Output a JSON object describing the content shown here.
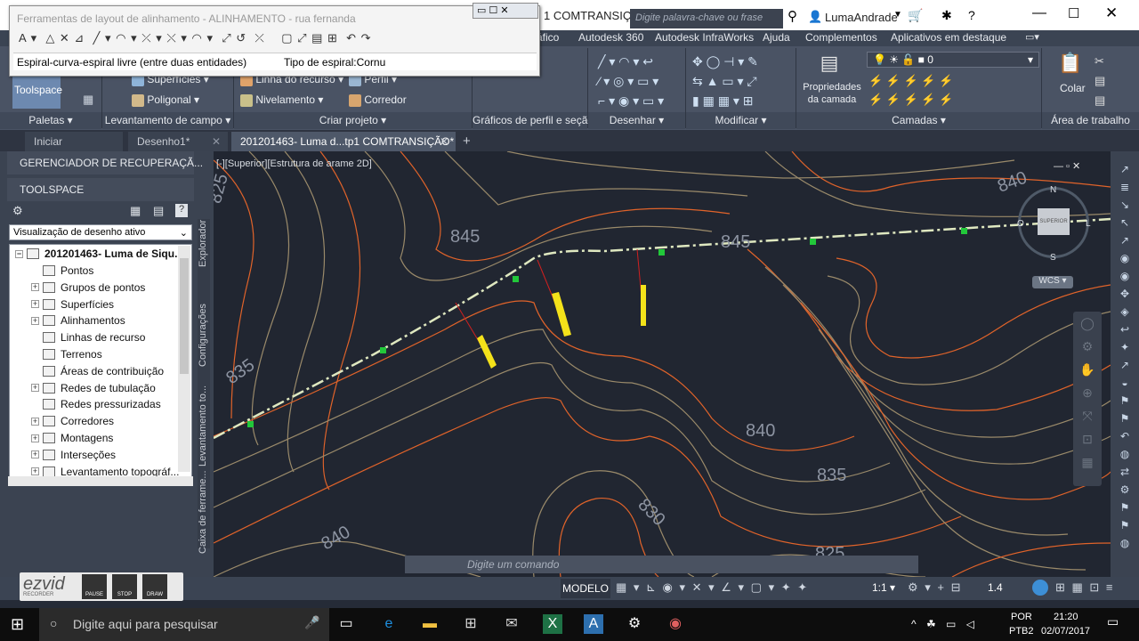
{
  "window": {
    "title_fragment": "1 COMTRANSIÇ...",
    "search_placeholder": "Digite palavra-chave ou frase",
    "user": "LumaAndrade"
  },
  "menu": [
    "áfico",
    "Autodesk 360",
    "Autodesk InfraWorks",
    "Ajuda",
    "Complementos",
    "Aplicativos em destaque"
  ],
  "ribbon": {
    "toolspace": "Toolspace",
    "superficies": "Superfícies",
    "poligonal": "Poligonal",
    "linha_recurso": "Linha do recurso",
    "nivelamento": "Nivelamento",
    "perfil": "Perfil",
    "corredor": "Corredor",
    "propriedades_camada": "Propriedades",
    "propriedades_camada2": "da camada",
    "layer_value": "0",
    "colar": "Colar",
    "panels": {
      "paletas": "Paletas",
      "levantamento": "Levantamento de campo",
      "criar_projeto": "Criar projeto",
      "graficos": "Gráficos de perfil e seção",
      "desenhar": "Desenhar",
      "modificar": "Modificar",
      "camadas": "Camadas",
      "area_trabalho": "Área de trabalho"
    }
  },
  "tabs": [
    "Iniciar",
    "Desenho1*",
    "201201463- Luma d...tp1 COMTRANSIÇÃO*"
  ],
  "floating_toolbar": {
    "title": "Ferramentas de layout de alinhamento - ALINHAMENTO - rua fernanda",
    "status_left": "Espiral-curva-espiral livre (entre duas entidades)",
    "status_right": "Tipo de espiral:Cornu"
  },
  "left_panel": {
    "recovery": "GERENCIADOR DE RECUPERAÇÃ...",
    "toolspace": "TOOLSPACE",
    "view_select": "Visualização de desenho ativo",
    "root": "201201463- Luma de Siqu...",
    "items": [
      "Pontos",
      "Grupos de pontos",
      "Superfícies",
      "Alinhamentos",
      "Linhas de recurso",
      "Terrenos",
      "Áreas de contribuição",
      "Redes de tubulação",
      "Redes pressurizadas",
      "Corredores",
      "Montagens",
      "Interseções",
      "Levantamento topográf..."
    ],
    "vtabs": [
      "Explorador",
      "Configurações",
      "Levantamento to...",
      "Caixa de ferrame..."
    ]
  },
  "canvas": {
    "view_label": "[-][Superior][Estrutura de arame 2D]",
    "contour_labels": [
      "845",
      "845",
      "840",
      "835",
      "840",
      "835",
      "830",
      "840",
      "825",
      "825"
    ],
    "viewcube": {
      "n": "N",
      "s": "S",
      "w": "O",
      "e": "L",
      "top": "SUPERIOR",
      "wcs": "WCS"
    },
    "command_placeholder": "Digite um comando"
  },
  "statusbar": {
    "modelo": "MODELO",
    "scale": "1:1",
    "lineweight": "1.4"
  },
  "ezvid": {
    "logo": "ezvid",
    "sub": "RECORDER",
    "pause": "PAUSE",
    "stop": "STOP",
    "draw": "DRAW"
  },
  "taskbar": {
    "search": "Digite aqui para pesquisar",
    "lang1": "POR",
    "lang2": "PTB2",
    "time": "21:20",
    "date": "02/07/2017"
  },
  "colors": {
    "contour_major": "#e0632a",
    "contour_minor": "#9a8a6a",
    "alignment": "#dfe8c0",
    "accent": "#3d8fd6"
  }
}
